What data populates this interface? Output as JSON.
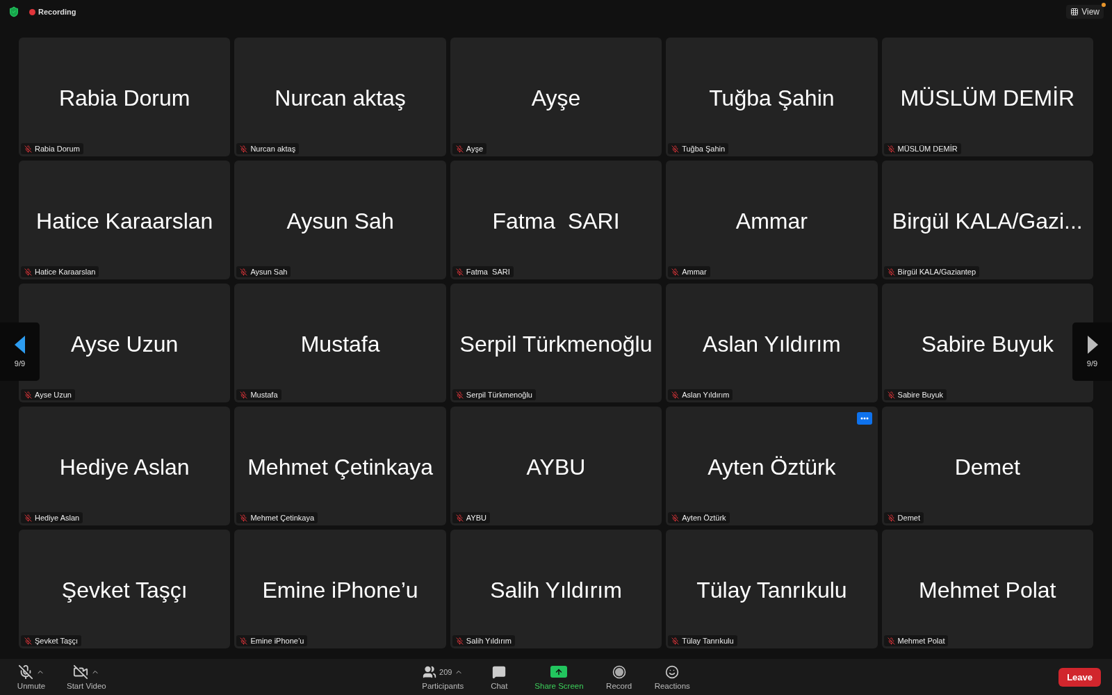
{
  "top_bar": {
    "recording": {
      "label": "Recording",
      "on": true
    },
    "view_button": {
      "label": "View",
      "notification": true
    }
  },
  "tiles": [
    {
      "name": "Rabia Dorum",
      "label": "Rabia Dorum",
      "muted": true,
      "more_button": false
    },
    {
      "name": "Nurcan aktaş",
      "label": "Nurcan aktaş",
      "muted": true,
      "more_button": false
    },
    {
      "name": "Ayşe",
      "label": "Ayşe",
      "muted": true,
      "more_button": false
    },
    {
      "name": "Tuğba Şahin",
      "label": "Tuğba Şahin",
      "muted": true,
      "more_button": false
    },
    {
      "name": "MÜSLÜM DEMİR",
      "label": "MÜSLÜM DEMİR",
      "muted": true,
      "more_button": false
    },
    {
      "name": "Hatice Karaarslan",
      "label": "Hatice Karaarslan",
      "muted": true,
      "more_button": false
    },
    {
      "name": "Aysun Sah",
      "label": "Aysun Sah",
      "muted": true,
      "more_button": false
    },
    {
      "name": "Fatma  SARI",
      "label": "Fatma  SARI",
      "muted": true,
      "more_button": false
    },
    {
      "name": "Ammar",
      "label": "Ammar",
      "muted": true,
      "more_button": false
    },
    {
      "name": "Birgül KALA/Gazi...",
      "label": "Birgül KALA/Gaziantep",
      "muted": true,
      "more_button": false
    },
    {
      "name": "Ayse Uzun",
      "label": "Ayse Uzun",
      "muted": true,
      "more_button": false
    },
    {
      "name": "Mustafa",
      "label": "Mustafa",
      "muted": true,
      "more_button": false
    },
    {
      "name": "Serpil Türkmenoğlu",
      "label": "Serpil Türkmenoğlu",
      "muted": true,
      "more_button": false
    },
    {
      "name": "Aslan Yıldırım",
      "label": "Aslan Yıldırım",
      "muted": true,
      "more_button": false
    },
    {
      "name": "Sabire Buyuk",
      "label": "Sabire Buyuk",
      "muted": true,
      "more_button": false
    },
    {
      "name": "Hediye Aslan",
      "label": "Hediye Aslan",
      "muted": true,
      "more_button": false
    },
    {
      "name": "Mehmet Çetinkaya",
      "label": "Mehmet Çetinkaya",
      "muted": true,
      "more_button": false
    },
    {
      "name": "AYBU",
      "label": "AYBU",
      "muted": true,
      "more_button": false
    },
    {
      "name": "Ayten Öztürk",
      "label": "Ayten Öztürk",
      "muted": true,
      "more_button": true
    },
    {
      "name": "Demet",
      "label": "Demet",
      "muted": true,
      "more_button": false
    },
    {
      "name": "Şevket Taşçı",
      "label": "Şevket Taşçı",
      "muted": true,
      "more_button": false
    },
    {
      "name": "Emine iPhone’u",
      "label": "Emine iPhone’u",
      "muted": true,
      "more_button": false
    },
    {
      "name": "Salih Yıldırım",
      "label": "Salih Yıldırım",
      "muted": true,
      "more_button": false
    },
    {
      "name": "Tülay Tanrıkulu",
      "label": "Tülay Tanrıkulu",
      "muted": true,
      "more_button": false
    },
    {
      "name": "Mehmet Polat",
      "label": "Mehmet Polat",
      "muted": true,
      "more_button": false
    }
  ],
  "pager": [
    {
      "kind": "previous",
      "page": "9/9",
      "active": true
    },
    {
      "kind": "next",
      "page": "9/9",
      "active": false
    }
  ],
  "toolbar": {
    "left": [
      {
        "kind": "mic",
        "label": "Unmute",
        "off": true,
        "caret": true
      },
      {
        "kind": "video",
        "label": "Start Video",
        "off": true,
        "caret": true
      }
    ],
    "center": [
      {
        "kind": "participants",
        "label": "Participants",
        "count": "209",
        "caret": true
      },
      {
        "kind": "chat",
        "label": "Chat",
        "caret": false
      },
      {
        "kind": "share",
        "label": "Share Screen",
        "caret": false
      },
      {
        "kind": "record",
        "label": "Record",
        "caret": false
      },
      {
        "kind": "reactions",
        "label": "Reactions",
        "caret": false
      }
    ],
    "leave": "Leave"
  }
}
